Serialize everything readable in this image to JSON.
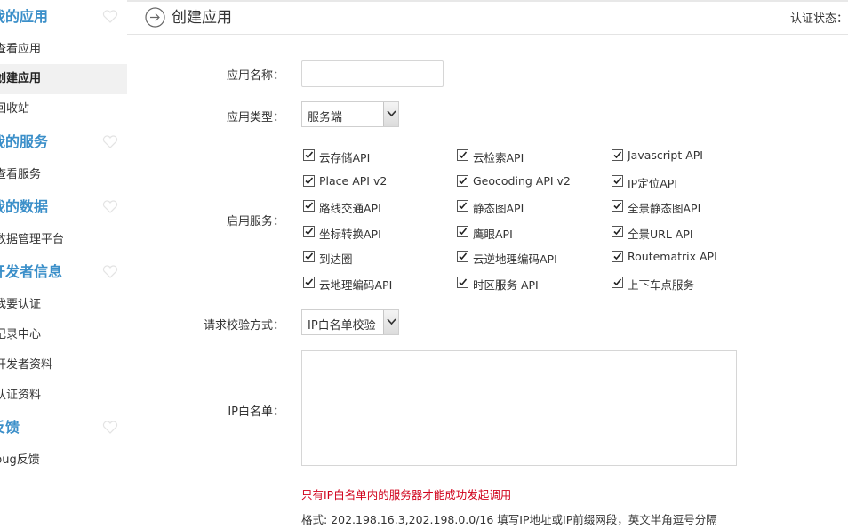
{
  "sidebar": {
    "groups": [
      {
        "title": "我的应用",
        "items": [
          "查看应用",
          "创建应用",
          "回收站"
        ]
      },
      {
        "title": "我的服务",
        "items": [
          "查看服务"
        ]
      },
      {
        "title": "我的数据",
        "items": [
          "数据管理平台"
        ]
      },
      {
        "title": "开发者信息",
        "items": [
          "我要认证",
          "记录中心",
          "开发者资料",
          "认证资料"
        ]
      },
      {
        "title": "反馈",
        "items": [
          "bug反馈"
        ]
      }
    ],
    "active_item": "创建应用"
  },
  "header": {
    "title": "创建应用",
    "auth_status_label": "认证状态："
  },
  "form": {
    "app_name_label": "应用名称：",
    "app_name_value": "",
    "app_type_label": "应用类型：",
    "app_type_value": "服务端",
    "services_label": "启用服务：",
    "services": [
      [
        "云存储API",
        "云检索API",
        "Javascript API"
      ],
      [
        "Place API v2",
        "Geocoding API v2",
        "IP定位API"
      ],
      [
        "路线交通API",
        "静态图API",
        "全景静态图API"
      ],
      [
        "坐标转换API",
        "鹰眼API",
        "全景URL API"
      ],
      [
        "到达圈",
        "云逆地理编码API",
        "Routematrix API"
      ],
      [
        "云地理编码API",
        "时区服务 API",
        "上下车点服务"
      ]
    ],
    "services_checked": true,
    "verify_label": "请求校验方式：",
    "verify_value": "IP白名单校验",
    "whitelist_label": "IP白名单：",
    "whitelist_value": "",
    "warning_text": "只有IP白名单内的服务器才能成功发起调用",
    "format_text": "格式: 202.198.16.3,202.198.0.0/16 填写IP地址或IP前缀网段，英文半角逗号分隔"
  },
  "colors": {
    "accent": "#3b8fc9",
    "warning": "#d0021b",
    "active_bg": "#f1f1f1"
  }
}
